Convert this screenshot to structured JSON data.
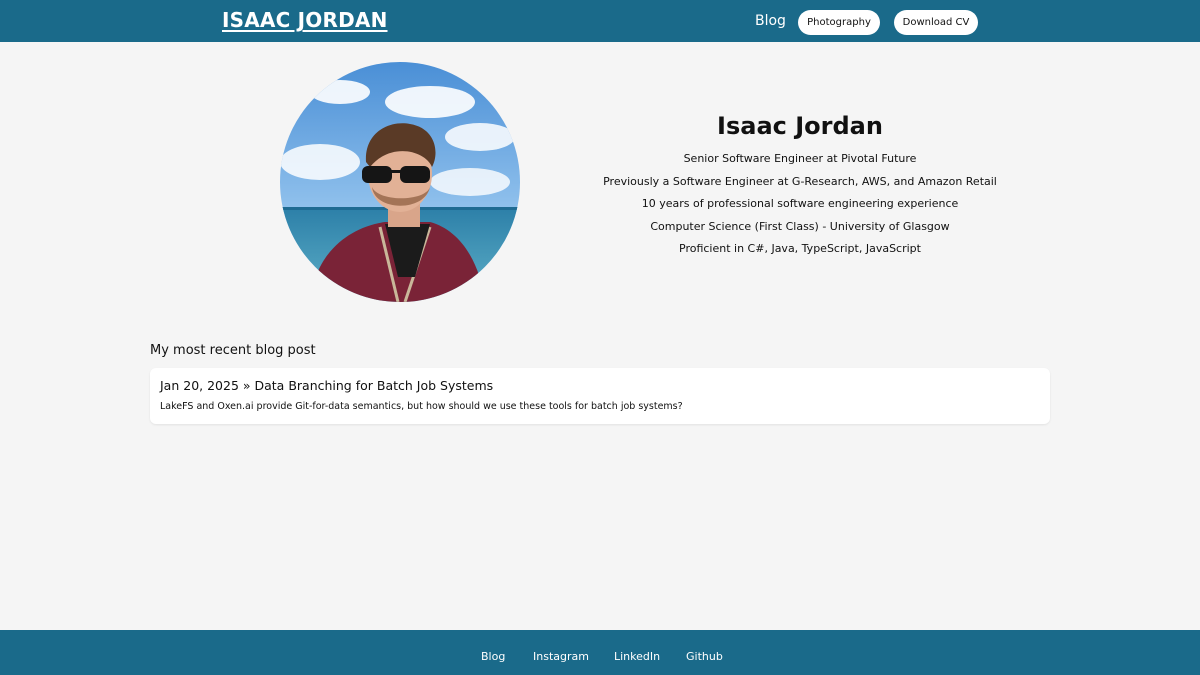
{
  "header": {
    "brand": "ISAAC JORDAN",
    "nav_blog": "Blog",
    "photography_button": "Photography",
    "download_cv_button": "Download CV",
    "bg_color": "#1a6a8a"
  },
  "profile": {
    "name": "Isaac Jordan",
    "lines": [
      "Senior Software Engineer at Pivotal Future",
      "Previously a Software Engineer at G-Research, AWS, and Amazon Retail",
      "10 years of professional software engineering experience",
      "Computer Science (First Class) - University of Glasgow",
      "Proficient in C#, Java, TypeScript, JavaScript"
    ]
  },
  "recent": {
    "heading": "My most recent blog post",
    "post": {
      "title": "Jan 20, 2025 » Data Branching for Batch Job Systems",
      "description": "LakeFS and Oxen.ai provide Git-for-data semantics, but how should we use these tools for batch job systems?"
    }
  },
  "footer": {
    "links": [
      "Blog",
      "Instagram",
      "LinkedIn",
      "Github"
    ]
  }
}
